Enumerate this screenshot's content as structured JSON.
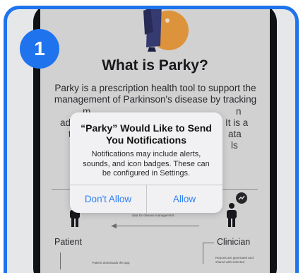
{
  "step_badge": "1",
  "screen": {
    "heading": "What is Parky?",
    "intro_lines": [
      "Parky is a prescription health tool to support the",
      "management of Parkinson's disease by tracking"
    ],
    "obscured_fragments": [
      "m",
      "n",
      "adhe",
      "It is a",
      "too",
      "ata",
      "b",
      "ls"
    ],
    "diagram": {
      "patient_label": "Patient",
      "clinician_label": "Clinician",
      "caption_lines": [
        "Clinician's decision making process is supported by objective",
        "data for disease management."
      ],
      "reports_lines": [
        "Reports are generated and",
        "shared with selected"
      ],
      "patient_note": "Patient downloads the app"
    }
  },
  "alert": {
    "title_lines": [
      "“Parky” Would Like to Send",
      "You Notifications"
    ],
    "message_lines": [
      "Notifications may include alerts,",
      "sounds, and icon badges. These can",
      "be configured in Settings."
    ],
    "dont_allow_label": "Don't Allow",
    "allow_label": "Allow"
  },
  "colors": {
    "accent": "#1f74ee",
    "ios_link": "#2f7ff3"
  }
}
